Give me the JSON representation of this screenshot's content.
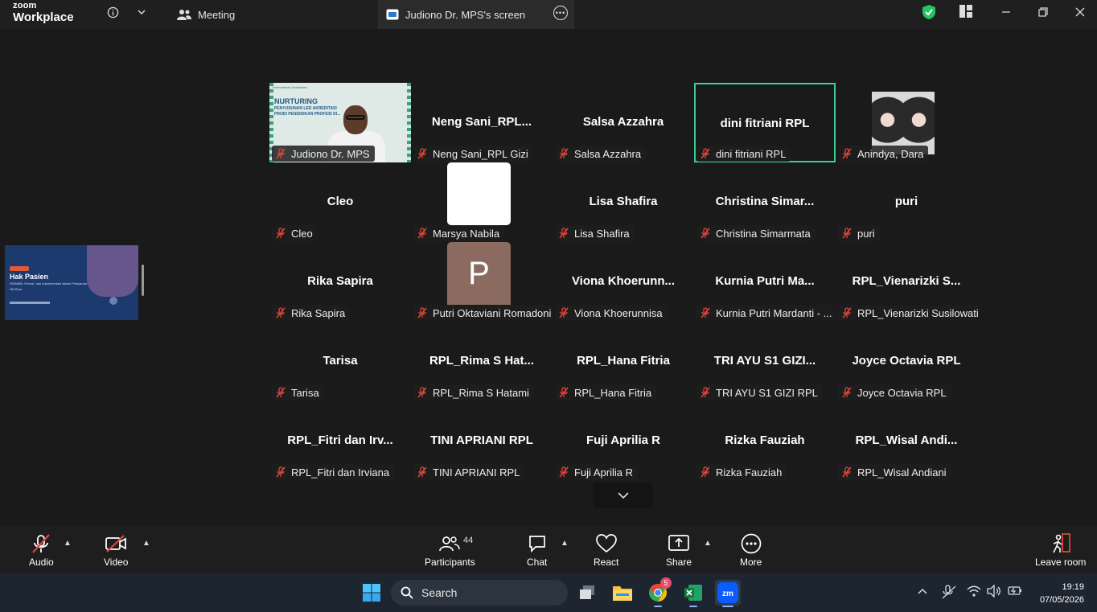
{
  "app": {
    "brand_top": "zoom",
    "brand_bottom": "Workplace"
  },
  "tabs": [
    {
      "label": "Meeting"
    },
    {
      "label": "Judiono Dr. MPS's screen"
    }
  ],
  "shared_thumb": {
    "title": "Hak Pasien",
    "subtitle": "RIKMMB, Privasi, dan Implementasi dalam Pelayanan",
    "sub2": "Siti Rina"
  },
  "video_slide": {
    "title": "NURTURING",
    "line1": "PENYUSUNAN LED AKREDITASI",
    "line2": "PRODI PENDIDIKAN PROFESI DI...",
    "banner": "Kementerian Kesehatan"
  },
  "participants": [
    {
      "name": "",
      "label": "Judiono Dr. MPS",
      "kind": "video"
    },
    {
      "name": "Neng  Sani_RPL...",
      "label": "Neng Sani_RPL Gizi"
    },
    {
      "name": "Salsa Azzahra",
      "label": "Salsa Azzahra"
    },
    {
      "name": "dini fitriani RPL",
      "label": "dini fitriani RPL",
      "active": true
    },
    {
      "name": "",
      "label": "Anindya, Dara",
      "kind": "photo"
    },
    {
      "name": "Cleo",
      "label": "Cleo"
    },
    {
      "name": "",
      "label": "Marsya Nabila",
      "kind": "white"
    },
    {
      "name": "Lisa Shafira",
      "label": "Lisa Shafira"
    },
    {
      "name": "Christina  Simar...",
      "label": "Christina Simarmata"
    },
    {
      "name": "puri",
      "label": "puri"
    },
    {
      "name": "Rika Sapira",
      "label": "Rika Sapira"
    },
    {
      "name": "P",
      "label": "Putri Oktaviani Romadoni",
      "kind": "initial"
    },
    {
      "name": "Viona  Khoerunn...",
      "label": "Viona Khoerunnisa"
    },
    {
      "name": "Kurnia  Putri  Ma...",
      "label": "Kurnia Putri Mardanti - ..."
    },
    {
      "name": "RPL_Vienarizki  S...",
      "label": "RPL_Vienarizki Susilowati..."
    },
    {
      "name": "Tarisa",
      "label": "Tarisa"
    },
    {
      "name": "RPL_Rima  S  Hat...",
      "label": "RPL_Rima S Hatami"
    },
    {
      "name": "RPL_Hana Fitria",
      "label": "RPL_Hana Fitria"
    },
    {
      "name": "TRI  AYU  S1  GIZI...",
      "label": "TRI AYU S1 GIZI RPL"
    },
    {
      "name": "Joyce Octavia RPL",
      "label": "Joyce Octavia RPL"
    },
    {
      "name": "RPL_Fitri  dan  Irv...",
      "label": "RPL_Fitri dan Irviana"
    },
    {
      "name": "TINI APRIANI RPL",
      "label": "TINI APRIANI RPL"
    },
    {
      "name": "Fuji Aprilia R",
      "label": "Fuji Aprilia R"
    },
    {
      "name": "Rizka Fauziah",
      "label": "Rizka Fauziah"
    },
    {
      "name": "RPL_Wisal  Andi...",
      "label": "RPL_Wisal Andiani"
    }
  ],
  "toolbar": {
    "audio": "Audio",
    "video": "Video",
    "participants": "Participants",
    "participants_count": "44",
    "chat": "Chat",
    "react": "React",
    "share": "Share",
    "more": "More",
    "leave": "Leave room"
  },
  "taskbar": {
    "search_placeholder": "Search",
    "chrome_badge": "5",
    "time": "19:19",
    "date": "07/05/2026"
  },
  "colors": {
    "active_speaker": "#3ccf91",
    "muted": "#e0453a",
    "shield": "#22c55e",
    "zoom_blue": "#0b5cff"
  }
}
